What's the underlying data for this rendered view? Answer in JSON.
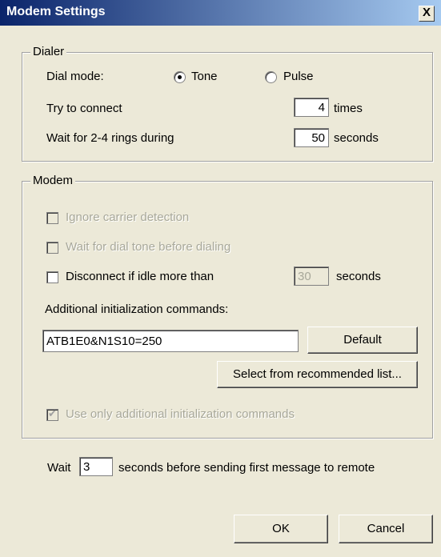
{
  "window": {
    "title": "Modem Settings",
    "close": "X"
  },
  "dialer": {
    "group_label": "Dialer",
    "dial_mode_label": "Dial mode:",
    "tone_label": "Tone",
    "pulse_label": "Pulse",
    "selected_mode": "Tone",
    "try_label": "Try to connect",
    "try_value": "4",
    "try_unit": "times",
    "wait_label": "Wait for 2-4 rings during",
    "wait_value": "50",
    "wait_unit": "seconds"
  },
  "modem": {
    "group_label": "Modem",
    "ignore_carrier": "Ignore carrier detection",
    "wait_dial_tone": "Wait for dial tone before dialing",
    "disconnect_label": "Disconnect if idle more than",
    "disconnect_value": "30",
    "disconnect_unit": "seconds",
    "additional_label": "Additional initialization commands:",
    "init_command": "ATB1E0&N1S10=250",
    "default_button": "Default",
    "select_button": "Select from recommended list...",
    "use_only_label": "Use only additional initialization commands"
  },
  "bottom": {
    "wait_label": "Wait",
    "wait_value": "3",
    "wait_suffix": "seconds before sending first message to remote"
  },
  "buttons": {
    "ok": "OK",
    "cancel": "Cancel"
  }
}
